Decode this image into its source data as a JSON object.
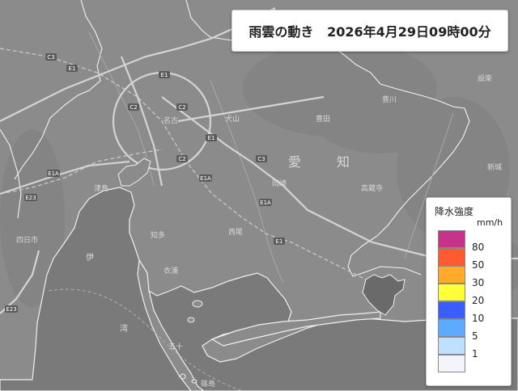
{
  "header": {
    "title": "雨雲の動き",
    "timestamp": "2026年4月29日09時00分"
  },
  "legend": {
    "title": "降水強度",
    "unit": "mm/h",
    "levels": [
      {
        "label": "80",
        "color": "#c8338a"
      },
      {
        "label": "50",
        "color": "#ff5a30"
      },
      {
        "label": "30",
        "color": "#ffaa2a"
      },
      {
        "label": "20",
        "color": "#ffff3a"
      },
      {
        "label": "10",
        "color": "#3b5cff"
      },
      {
        "label": "5",
        "color": "#5eaaff"
      },
      {
        "label": "1",
        "color": "#bfe0ff"
      },
      {
        "label": "",
        "color": "#f4f4fb"
      }
    ]
  },
  "map": {
    "prefecture_label": [
      "愛",
      "知"
    ],
    "road_shields": [
      "C3",
      "E1",
      "E1",
      "C2",
      "C2",
      "C2",
      "E1",
      "C3",
      "E1A",
      "E1A",
      "E1",
      "E1A",
      "E23",
      "E23"
    ],
    "place_labels": [
      "伊",
      "湾",
      "衣浦",
      "知多",
      "五十",
      "名古",
      "豊田",
      "犬山",
      "高蔵寺",
      "西尾",
      "豊川",
      "新城",
      "岡崎",
      "設楽",
      "津島",
      "四日市",
      "篠島"
    ]
  }
}
